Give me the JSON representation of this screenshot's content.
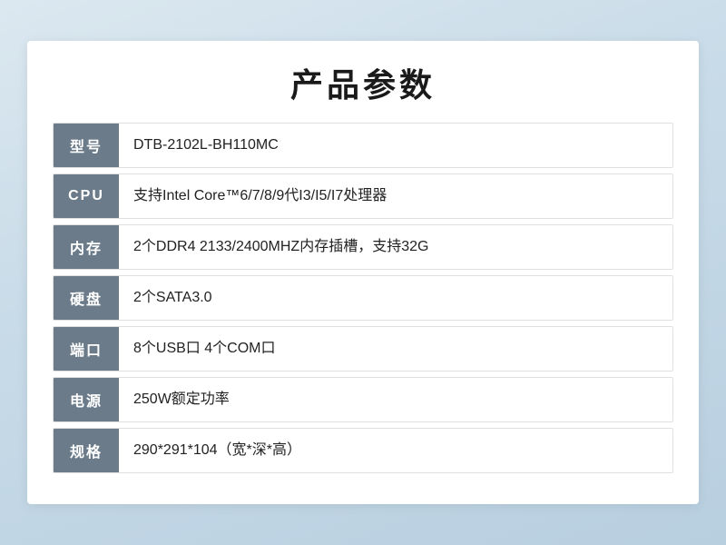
{
  "page": {
    "title": "产品参数",
    "specs": [
      {
        "label": "型号",
        "value": "DTB-2102L-BH110MC"
      },
      {
        "label": "CPU",
        "value": "支持Intel Core™6/7/8/9代I3/I5/I7处理器"
      },
      {
        "label": "内存",
        "value": "2个DDR4 2133/2400MHZ内存插槽，支持32G"
      },
      {
        "label": "硬盘",
        "value": "2个SATA3.0"
      },
      {
        "label": "端口",
        "value": "8个USB口 4个COM口"
      },
      {
        "label": "电源",
        "value": "250W额定功率"
      },
      {
        "label": "规格",
        "value": "290*291*104（宽*深*高）"
      }
    ]
  }
}
